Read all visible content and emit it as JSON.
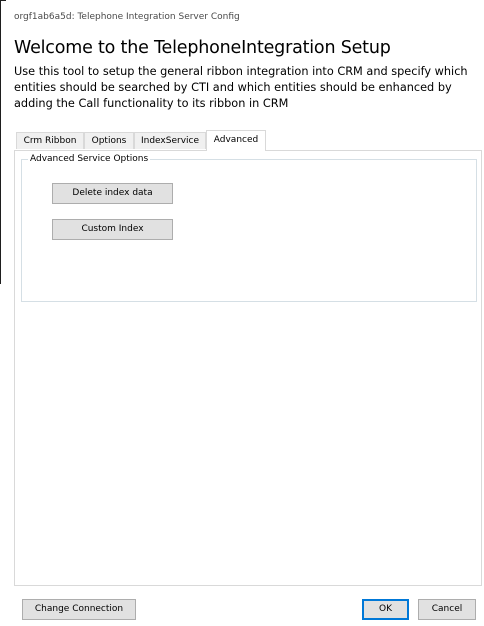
{
  "window": {
    "title": "orgf1ab6a5d: Telephone Integration Server Config"
  },
  "header": {
    "heading": "Welcome to the TelephoneIntegration Setup",
    "description": "Use this tool to setup the general ribbon integration into CRM and specify which entities should be searched by CTI and which entities should be enhanced by adding the Call functionality to its ribbon in CRM"
  },
  "tabs": [
    {
      "label": "Crm Ribbon",
      "active": false
    },
    {
      "label": "Options",
      "active": false
    },
    {
      "label": "IndexService",
      "active": false
    },
    {
      "label": "Advanced",
      "active": true
    }
  ],
  "advanced": {
    "group_title": "Advanced Service Options",
    "delete_index_label": "Delete index data",
    "custom_index_label": "Custom Index"
  },
  "footer": {
    "change_connection_label": "Change Connection",
    "ok_label": "OK",
    "cancel_label": "Cancel"
  },
  "colors": {
    "focus_border": "#0078d7",
    "button_face": "#e1e1e1",
    "tab_inactive": "#f0f0f0",
    "title_text": "#4a4a4a"
  }
}
